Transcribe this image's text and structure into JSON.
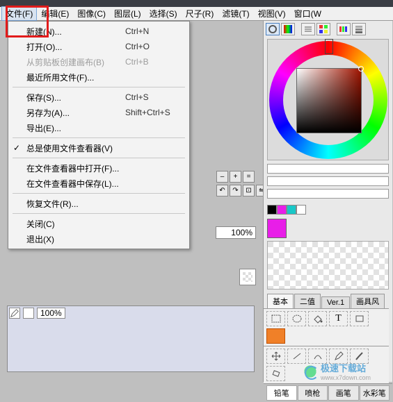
{
  "menubar": [
    "文件(F)",
    "编辑(E)",
    "图像(C)",
    "图层(L)",
    "选择(S)",
    "尺子(R)",
    "滤镜(T)",
    "视图(V)",
    "窗口(W"
  ],
  "menubar_active": 0,
  "dropdown": {
    "groups": [
      [
        {
          "label": "新建(N)...",
          "shortcut": "Ctrl+N",
          "disabled": false
        },
        {
          "label": "打开(O)...",
          "shortcut": "Ctrl+O",
          "disabled": false
        },
        {
          "label": "从剪贴板创建画布(B)",
          "shortcut": "Ctrl+B",
          "disabled": true
        },
        {
          "label": "最近所用文件(F)...",
          "shortcut": "",
          "disabled": false
        }
      ],
      [
        {
          "label": "保存(S)...",
          "shortcut": "Ctrl+S",
          "disabled": false
        },
        {
          "label": "另存为(A)...",
          "shortcut": "Shift+Ctrl+S",
          "disabled": false
        },
        {
          "label": "导出(E)...",
          "shortcut": "",
          "disabled": false
        }
      ],
      [
        {
          "label": "总是使用文件查看器(V)",
          "shortcut": "",
          "disabled": false,
          "checked": true
        }
      ],
      [
        {
          "label": "在文件查看器中打开(F)...",
          "shortcut": "",
          "disabled": false
        },
        {
          "label": "在文件查看器中保存(L)...",
          "shortcut": "",
          "disabled": false
        }
      ],
      [
        {
          "label": "恢复文件(R)...",
          "shortcut": "",
          "disabled": false
        }
      ],
      [
        {
          "label": "关闭(C)",
          "shortcut": "",
          "disabled": false
        },
        {
          "label": "退出(X)",
          "shortcut": "",
          "disabled": false
        }
      ]
    ]
  },
  "zoom_buttons": [
    "–",
    "+",
    "="
  ],
  "rotate_buttons": [
    "↶",
    "↷",
    "⊡",
    "⇋"
  ],
  "zoom_percent": "100%",
  "left_bottom_percent": "100%",
  "color_toolrow_icons": [
    "ring-icon",
    "spectrum-icon",
    "sliders-icon",
    "swatches-icon",
    "palette-icon",
    "history-icon"
  ],
  "sliders": [
    "",
    "",
    ""
  ],
  "swatch_colors": [
    "#000000",
    "#e81ee8",
    "#18c8c8",
    "#ffffff"
  ],
  "big_swatch": "#e81ee8",
  "tabs": [
    "基本",
    "二值",
    "Ver.1",
    "画具风"
  ],
  "tabs_active": 0,
  "tool_grid": [
    {
      "name": "select-rect-icon"
    },
    {
      "name": "select-free-icon"
    },
    {
      "name": "bucket-icon"
    },
    {
      "name": "text-icon",
      "glyph": "T"
    },
    {
      "name": "shape-icon"
    },
    {
      "name": "color-icon",
      "orange": true
    }
  ],
  "tool_grid2": [
    {
      "name": "move-icon"
    },
    {
      "name": "line-icon"
    },
    {
      "name": "curve-icon"
    },
    {
      "name": "pen-icon"
    },
    {
      "name": "brush-icon"
    },
    {
      "name": "eraser-icon"
    }
  ],
  "brush_tabs": [
    "铅笔",
    "喷枪",
    "画笔",
    "水彩笔"
  ],
  "brush_tab_active": 0,
  "watermark": {
    "title": "极速下载站",
    "sub": "www.x7down.com"
  }
}
